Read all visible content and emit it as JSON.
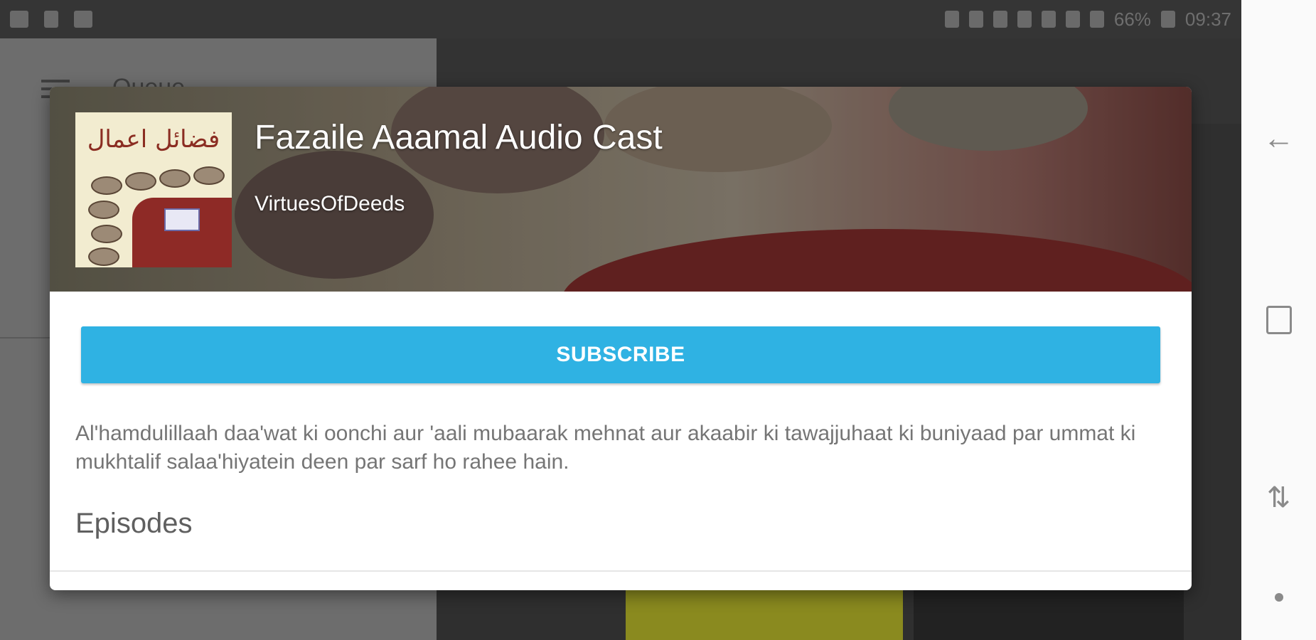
{
  "status_bar": {
    "battery": "66%",
    "time": "09:37"
  },
  "background": {
    "queue_label": "Queue"
  },
  "dialog": {
    "title": "Fazaile Aaamal Audio Cast",
    "author": "VirtuesOfDeeds",
    "subscribe_label": "SUBSCRIBE",
    "description": "Al'hamdulillaah daa'wat ki oonchi aur 'aali mubaarak mehnat aur akaabir ki tawajjuhaat ki buniyaad par ummat ki mukhtalif salaa'hiyatein deen par sarf ho rahee hain.",
    "episodes_heading": "Episodes",
    "subscribe_color": "#2fb2e3"
  },
  "nav": {
    "icons": [
      "back-icon",
      "home-icon",
      "recents-icon",
      "dot-icon"
    ]
  }
}
